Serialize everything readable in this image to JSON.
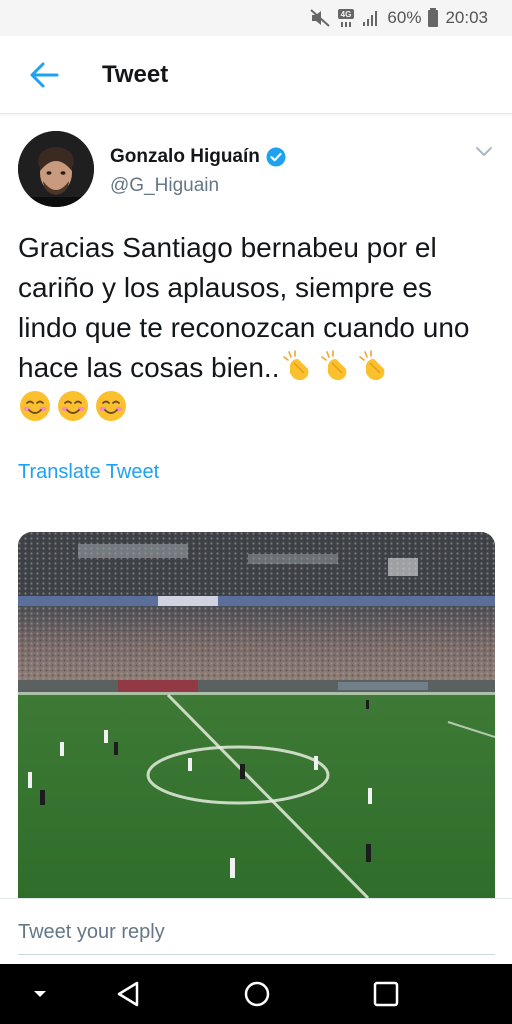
{
  "status_bar": {
    "battery": "60%",
    "time": "20:03",
    "network": "4G",
    "icons": [
      "mute-icon",
      "network-4g-icon",
      "signal-icon",
      "battery-icon"
    ]
  },
  "header": {
    "title": "Tweet",
    "back_icon": "arrow-left-icon",
    "accent_color": "#1da1f2"
  },
  "tweet": {
    "user": {
      "name": "Gonzalo Higuaín",
      "handle": "@G_Higuain",
      "verified": true
    },
    "text": "Gracias Santiago bernabeu por el cariño y los aplausos, siempre es lindo que te reconozcan cuando uno hace las cosas bien..",
    "emojis_inline": [
      "clapping-hands-emoji",
      "clapping-hands-emoji",
      "clapping-hands-emoji"
    ],
    "emojis_next_line": [
      "smiling-face-emoji",
      "smiling-face-emoji",
      "smiling-face-emoji"
    ],
    "translate_label": "Translate Tweet",
    "media": {
      "type": "video-still",
      "icon": "stadium-image"
    }
  },
  "reply": {
    "placeholder": "Tweet your reply"
  },
  "nav": {
    "items": [
      "collapse-icon",
      "back-triangle-icon",
      "home-circle-icon",
      "recents-square-icon"
    ]
  }
}
